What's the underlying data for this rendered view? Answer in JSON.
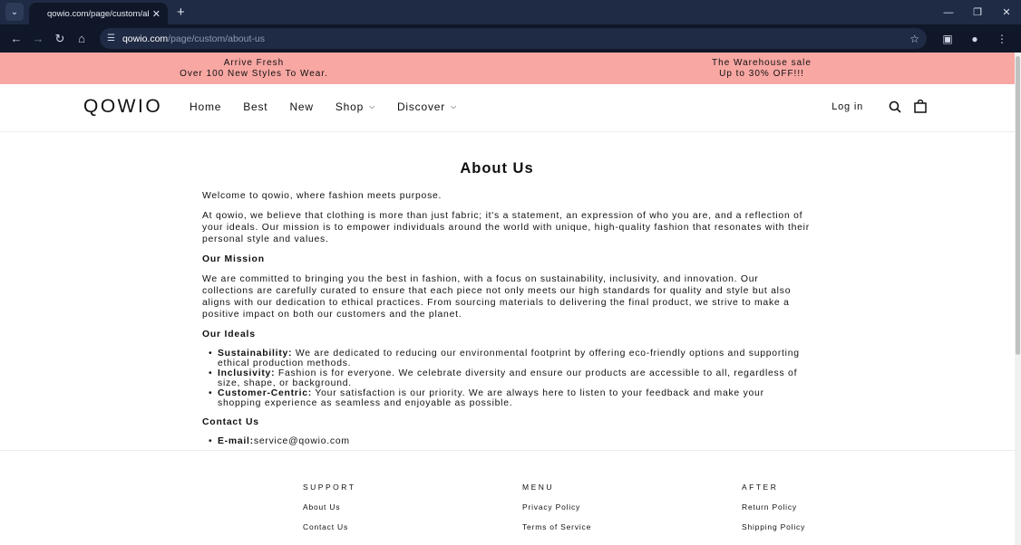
{
  "browser": {
    "tab_title": "qowio.com/page/custom/about-us",
    "url_host": "qowio.com",
    "url_path": "/page/custom/about-us"
  },
  "announcement": {
    "left_line1": "Arrive Fresh",
    "left_line2": "Over 100 New Styles To Wear.",
    "right_line1": "The Warehouse sale",
    "right_line2": "Up to 30% OFF!!!"
  },
  "header": {
    "logo": "QOWIO",
    "nav": [
      "Home",
      "Best",
      "New",
      "Shop",
      "Discover"
    ],
    "login": "Log in"
  },
  "content": {
    "title": "About Us",
    "welcome": "Welcome to qowio, where fashion meets purpose.",
    "intro": "At qowio, we believe that clothing is more than just fabric; it's a statement, an expression of who you are, and a reflection of your ideals. Our mission is to empower individuals around the world with unique, high-quality fashion that resonates with their personal style and values.",
    "mission_heading": "Our Mission",
    "mission_text": "We are committed to bringing you the best in fashion, with a focus on sustainability, inclusivity, and innovation. Our collections are carefully curated to ensure that each piece not only meets our high standards for quality and style but also aligns with our dedication to ethical practices. From sourcing materials to delivering the final product, we strive to make a positive impact on both our customers and the planet.",
    "ideals_heading": "Our Ideals",
    "ideals": [
      {
        "term": "Sustainability:",
        "text": " We are dedicated to reducing our environmental footprint by offering eco-friendly options and supporting ethical production methods."
      },
      {
        "term": "Inclusivity:",
        "text": " Fashion is for everyone. We celebrate diversity and ensure our products are accessible to all, regardless of size, shape, or background."
      },
      {
        "term": "Customer-Centric:",
        "text": " Your satisfaction is our priority. We are always here to listen to your feedback and make your shopping experience as seamless and enjoyable as possible."
      }
    ],
    "contact_heading": "Contact Us",
    "email_label": "E-mail:",
    "email": "service@qowio.com"
  },
  "footer": {
    "support": {
      "heading": "SUPPORT",
      "links": [
        "About Us",
        "Contact Us"
      ]
    },
    "menu": {
      "heading": "MENU",
      "links": [
        "Privacy Policy",
        "Terms of Service"
      ]
    },
    "after": {
      "heading": "AFTER",
      "links": [
        "Return Policy",
        "Shipping Policy"
      ]
    }
  }
}
